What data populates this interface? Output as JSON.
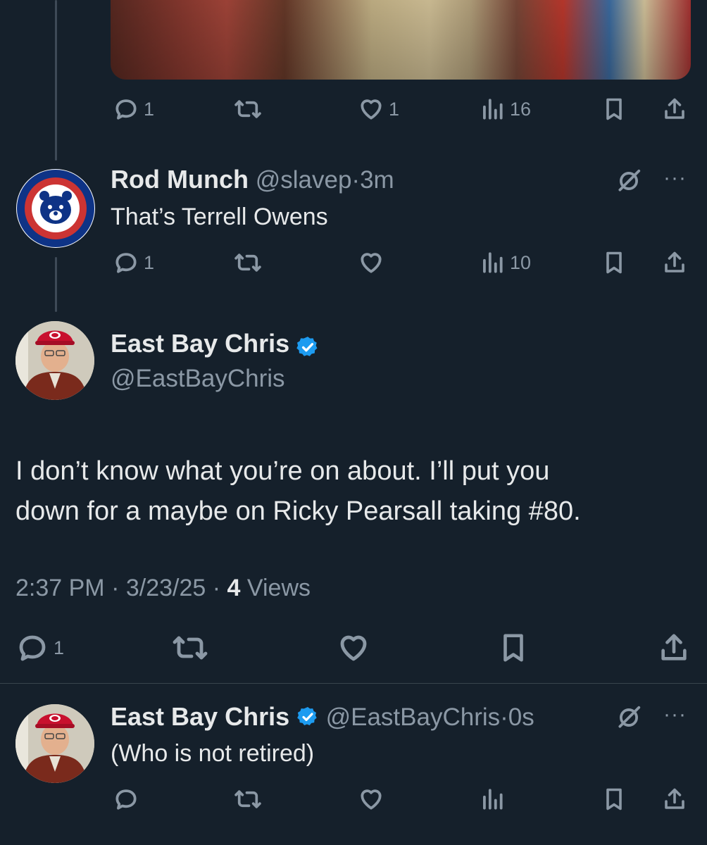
{
  "tweet0": {
    "reply_count": "1",
    "like_count": "1",
    "views": "16"
  },
  "tweet1": {
    "name": "Rod Munch",
    "handle": "@slavep",
    "sep": "·",
    "time": "3m",
    "text": "That’s Terrell Owens",
    "reply_count": "1",
    "views": "10"
  },
  "main": {
    "name": "East Bay Chris",
    "handle": "@EastBayChris",
    "text_line1": "I don’t know what you’re on about. I’ll put you",
    "text_line2": "down for a maybe on Ricky Pearsall taking #80.",
    "time": "2:37 PM",
    "sep": "·",
    "date": "3/23/25",
    "views_count": "4",
    "views_label": "Views",
    "reply_count": "1"
  },
  "tweet3": {
    "name": "East Bay Chris",
    "handle": "@EastBayChris",
    "sep": "·",
    "time": "0s",
    "text": "(Who is not retired)"
  },
  "more_label": "···",
  "colors": {
    "background": "#15202b",
    "muted": "#8b98a5",
    "verified": "#1d9bf0",
    "cubs_blue": "#0e3386",
    "cubs_red": "#cc3433",
    "hat_red": "#c8102e"
  }
}
